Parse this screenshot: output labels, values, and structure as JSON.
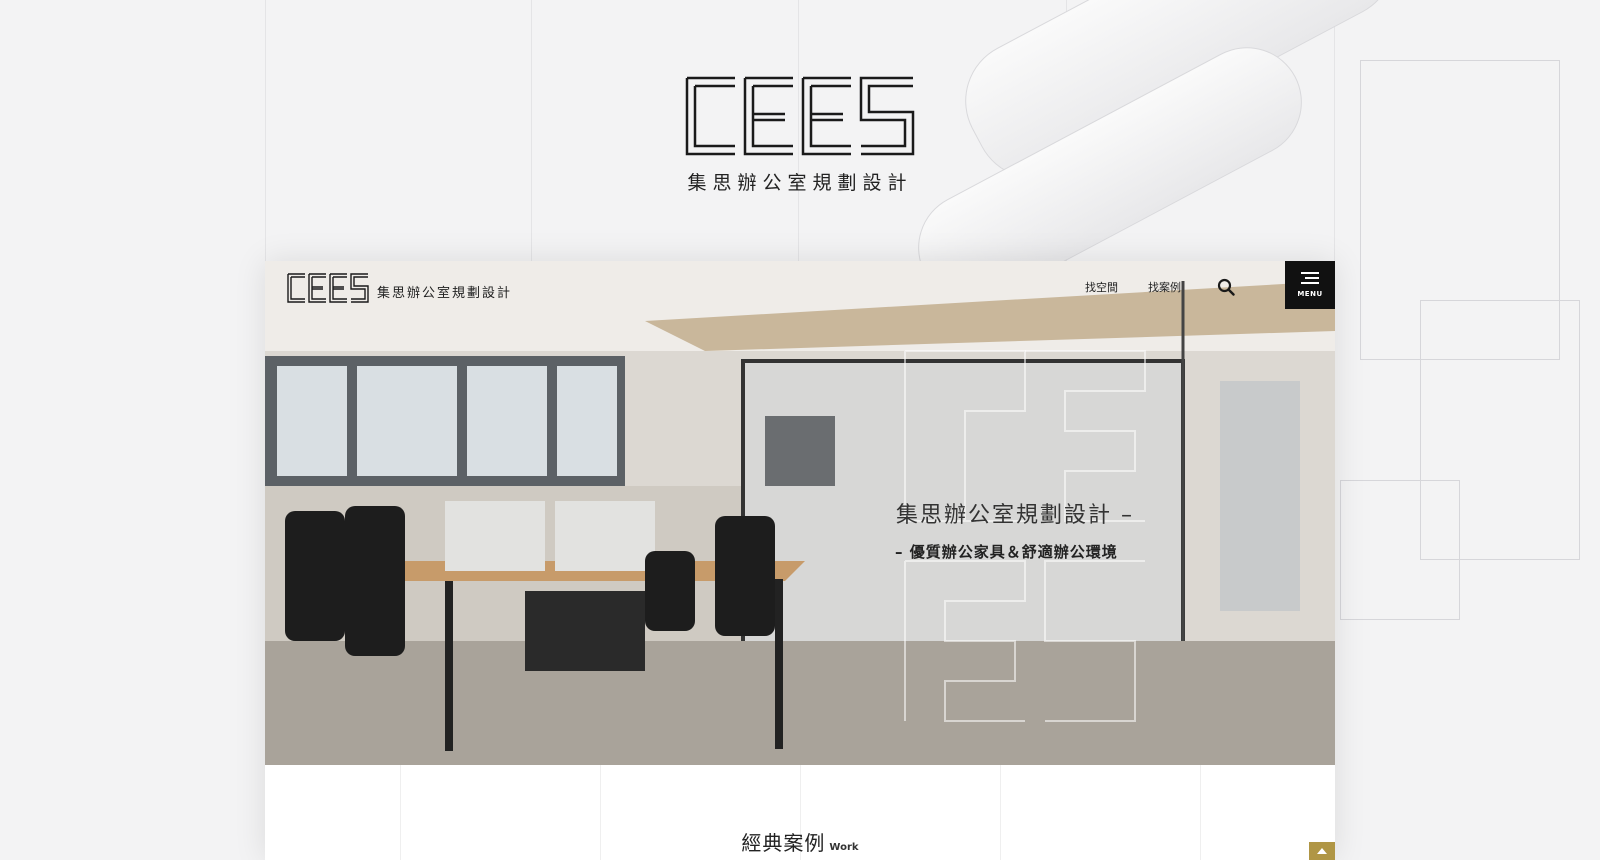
{
  "brand": {
    "name_zh": "集思辦公室規劃設計",
    "logo_alt": "CEES"
  },
  "nav": {
    "links": [
      "找空間",
      "找案例"
    ],
    "menu_label": "MENU"
  },
  "hero": {
    "tagline_main": "集思辦公室規劃設計 –",
    "tagline_sub": "– 優質辦公家具＆舒適辦公環境"
  },
  "section": {
    "title_zh": "經典案例",
    "title_en": "Work"
  },
  "icons": {
    "search": "search-icon",
    "menu": "hamburger-icon",
    "back_to_top": "chevron-up-icon"
  },
  "colors": {
    "accent": "#b09645",
    "menu_bg": "#111111"
  }
}
